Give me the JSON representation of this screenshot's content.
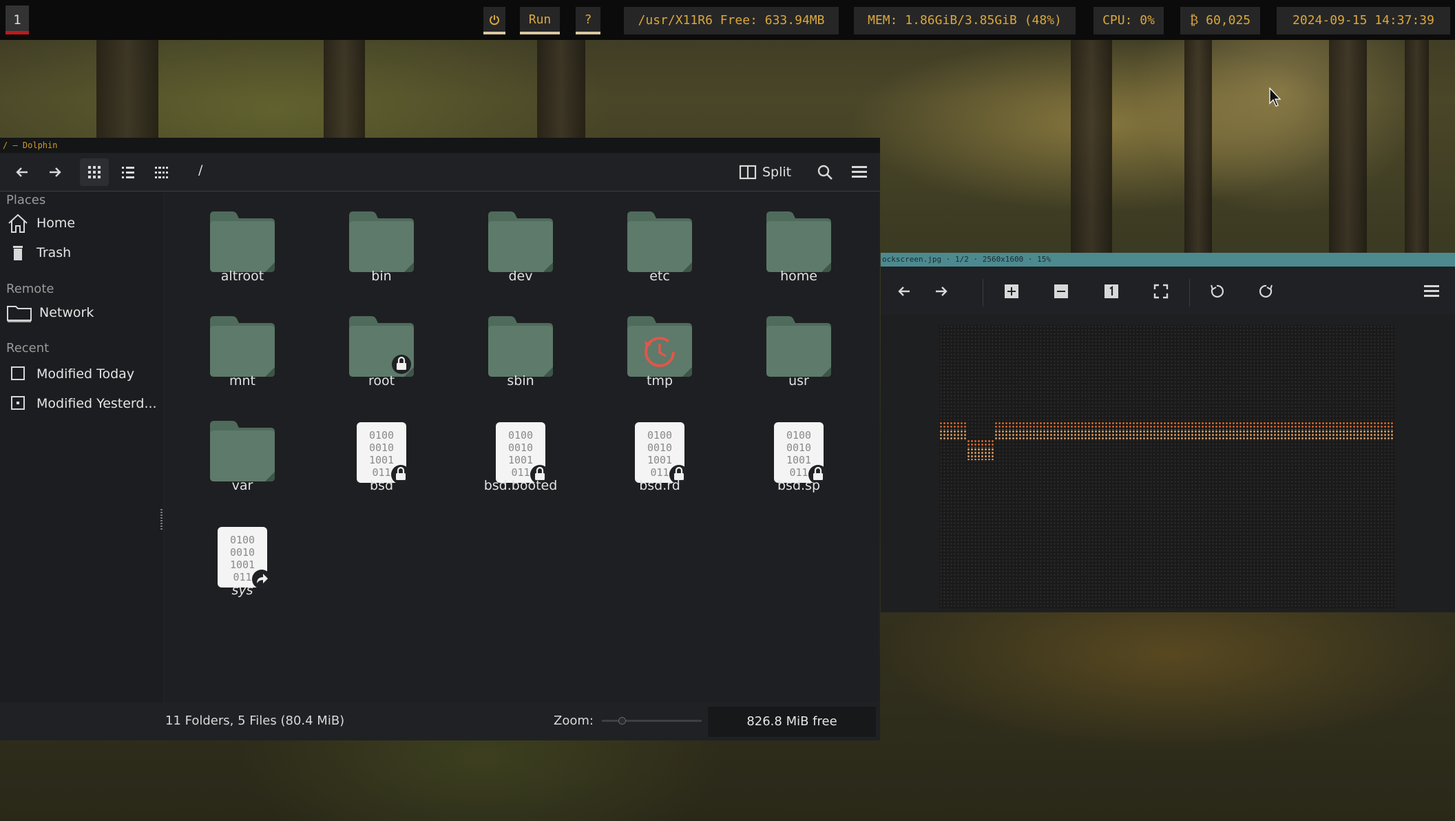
{
  "topbar": {
    "workspace": "1",
    "power_icon": "⏻",
    "run_label": "Run",
    "help_label": "?",
    "disk": "/usr/X11R6 Free: 633.94MB",
    "mem": "MEM: 1.86GiB/3.85GiB (48%)",
    "cpu": "CPU: 0%",
    "btc": "₿ 60,025",
    "datetime": "2024-09-15 14:37:39"
  },
  "dolphin": {
    "window_title": "/ — Dolphin",
    "path": "/",
    "split_label": "Split",
    "sidebar": {
      "places_header": "Places",
      "home": "Home",
      "trash": "Trash",
      "remote_header": "Remote",
      "network": "Network",
      "recent_header": "Recent",
      "modified_today": "Modified Today",
      "modified_yesterday": "Modified Yesterd..."
    },
    "items": [
      {
        "name": "altroot",
        "kind": "folder"
      },
      {
        "name": "bin",
        "kind": "folder"
      },
      {
        "name": "dev",
        "kind": "folder"
      },
      {
        "name": "etc",
        "kind": "folder"
      },
      {
        "name": "home",
        "kind": "folder"
      },
      {
        "name": "mnt",
        "kind": "folder"
      },
      {
        "name": "root",
        "kind": "folder-locked"
      },
      {
        "name": "sbin",
        "kind": "folder"
      },
      {
        "name": "tmp",
        "kind": "folder-temp"
      },
      {
        "name": "usr",
        "kind": "folder"
      },
      {
        "name": "var",
        "kind": "folder"
      },
      {
        "name": "bsd",
        "kind": "binary-locked"
      },
      {
        "name": "bsd.booted",
        "kind": "binary-locked"
      },
      {
        "name": "bsd.rd",
        "kind": "binary-locked"
      },
      {
        "name": "bsd.sp",
        "kind": "binary-locked"
      },
      {
        "name": "sys",
        "kind": "binary-link"
      }
    ],
    "status": "11 Folders, 5 Files (80.4 MiB)",
    "zoom_label": "Zoom:",
    "zoom_level": 0.2,
    "free_space": "826.8 MiB free"
  },
  "viewer": {
    "title": "ockscreen.jpg · 1/2 · 2560x1600 · 15%"
  },
  "colors": {
    "accent_orange": "#d9a73e",
    "workspace_marker": "#c01a1a",
    "folder": "#5d7a6a",
    "viewer_title_bg": "#4c8a90"
  }
}
